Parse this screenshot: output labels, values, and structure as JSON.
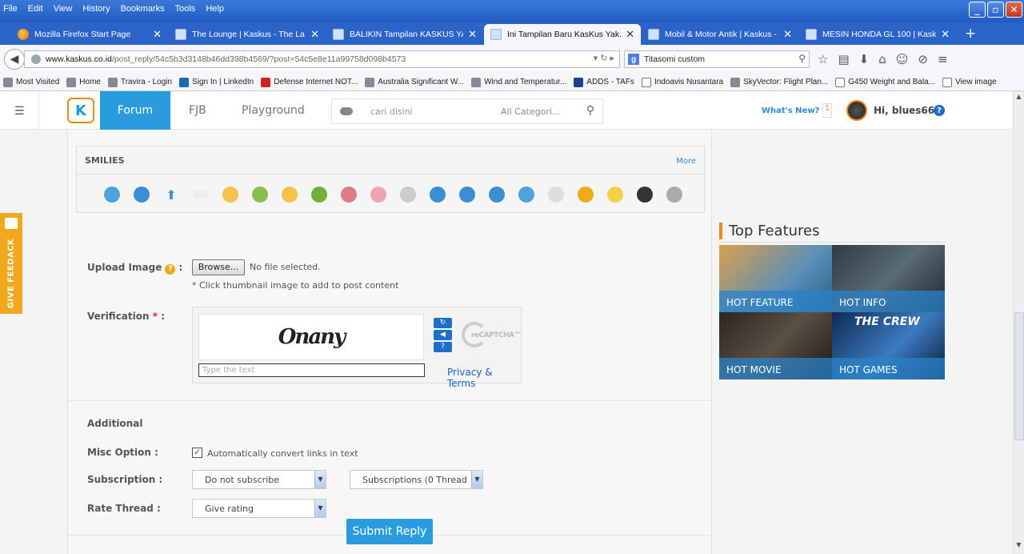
{
  "browser": {
    "menu": [
      "File",
      "Edit",
      "View",
      "History",
      "Bookmarks",
      "Tools",
      "Help"
    ],
    "tabs": [
      {
        "title": "Mozilla Firefox Start Page",
        "active": false
      },
      {
        "title": "The Lounge | Kaskus - The La...",
        "active": false
      },
      {
        "title": "BALIKIN Tampilan KASKUS YA...",
        "active": false
      },
      {
        "title": "Ini Tampilan Baru KasKus Yak...",
        "active": true
      },
      {
        "title": "Mobil & Motor Antik | Kaskus - ...",
        "active": false
      },
      {
        "title": "MESIN HONDA GL 100 | Kask...",
        "active": false
      }
    ],
    "url_domain": "www.kaskus.co.id",
    "url_path": "/post_reply/54c5b3d3148b46dd398b4569/?post=54c5e8e11a99758d098b4573",
    "search_value": "Titasomi custom",
    "bookmarks": [
      "Most Visited",
      "Home",
      "Travira - Login",
      "Sign In | LinkedIn",
      "Defense Internet NOT...",
      "Australia Significant W...",
      "Wind and Temperatur...",
      "ADDS - TAFs",
      "Indoavis Nusantara",
      "SkyVector: Flight Plan...",
      "G450 Weight and Bala...",
      "View image"
    ]
  },
  "site": {
    "nav": {
      "forum": "Forum",
      "fjb": "FJB",
      "playground": "Playground"
    },
    "search_placeholder": "cari disini",
    "category": "All Categori...",
    "whats_new": "What's New?",
    "notif_count": "1",
    "user_greeting": "Hi, blues66",
    "feedback": "GIVE FEEDACK"
  },
  "form": {
    "smilies_title": "SMILIES",
    "smilies_more": "More",
    "upload_label": "Upload Image",
    "browse_label": "Browse...",
    "no_file": "No file selected.",
    "upload_hint": "* Click thumbnail image to add to post content",
    "verification_label": "Verification",
    "captcha_text": "Onany",
    "captcha_placeholder": "Type the text",
    "privacy_terms": "Privacy & Terms",
    "recaptcha_brand": "reCAPTCHA™",
    "additional": "Additional",
    "misc_label": "Misc Option :",
    "misc_checkbox": "Automatically convert links in text",
    "subscription_label": "Subscription :",
    "subscription_value": "Do not subscribe",
    "subscriptions_value": "Subscriptions (0 Thread",
    "rate_label": "Rate Thread :",
    "rate_value": "Give rating",
    "submit": "Submit Reply"
  },
  "sidebar": {
    "title": "Top Features",
    "features": [
      {
        "label": "HOT FEATURE",
        "color": "#b5893a"
      },
      {
        "label": "HOT INFO",
        "color": "#3c4a55"
      },
      {
        "label": "HOT MOVIE",
        "color": "#3a3530"
      },
      {
        "label": "HOT GAMES",
        "color": "#1a3f6e"
      }
    ]
  }
}
